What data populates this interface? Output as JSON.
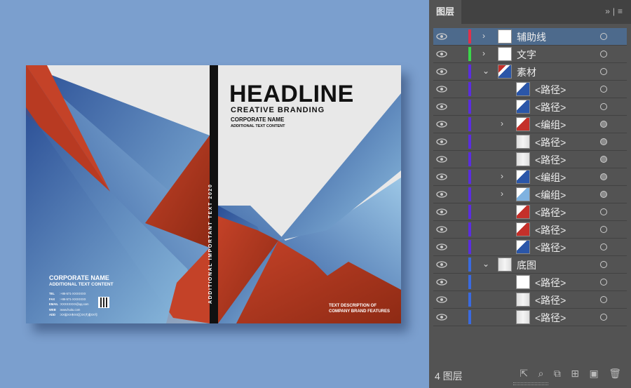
{
  "cover": {
    "headline": "HEADLINE",
    "subtitle": "CREATIVE BRANDING",
    "corporate": "CORPORATE NAME",
    "additional": "ADDITIONAL TEXT CONTENT",
    "spine": "ADDITIONAL IMPORTANT TEXT 2020",
    "back_name": "CORPORATE NAME",
    "back_add": "ADDITIONAL TEXT CONTENT",
    "contacts": [
      {
        "k": "TEL",
        "v": ":+86-571-XXXXXXX"
      },
      {
        "k": "FAX",
        "v": ":+86-571-XXXXXXX"
      },
      {
        "k": "EMAIL",
        "v": ":XXXXXXXX@qq.com"
      },
      {
        "k": "WEB",
        "v": ":www.huitu.com"
      },
      {
        "k": "ADD",
        "v": ":XX省XX市XX区XX大道XX号"
      }
    ],
    "desc1": "TEXT DESCRIPTION OF",
    "desc2": "COMPANY BRAND FEATURES"
  },
  "panel": {
    "tab": "图层",
    "count": "4 图层",
    "rows": [
      {
        "name": "辅助线",
        "color": "#e0314b",
        "chev": "›",
        "indent": 0,
        "thumb": "white",
        "circ": "empty",
        "sel": true
      },
      {
        "name": "文字",
        "color": "#3bd64a",
        "chev": "›",
        "indent": 0,
        "thumb": "text",
        "circ": "empty"
      },
      {
        "name": "素材",
        "color": "#5b2de0",
        "chev": "⌄",
        "indent": 0,
        "thumb": "mix",
        "circ": "empty"
      },
      {
        "name": "<路径>",
        "color": "#5b2de0",
        "chev": "",
        "indent": 1,
        "thumb": "blue",
        "circ": "empty"
      },
      {
        "name": "<路径>",
        "color": "#5b2de0",
        "chev": "",
        "indent": 1,
        "thumb": "blue",
        "circ": "empty"
      },
      {
        "name": "<编组>",
        "color": "#5b2de0",
        "chev": "›",
        "indent": 1,
        "thumb": "red",
        "circ": "fill"
      },
      {
        "name": "<路径>",
        "color": "#5b2de0",
        "chev": "",
        "indent": 1,
        "thumb": "grey",
        "circ": "fill"
      },
      {
        "name": "<路径>",
        "color": "#5b2de0",
        "chev": "",
        "indent": 1,
        "thumb": "grey",
        "circ": "fill"
      },
      {
        "name": "<编组>",
        "color": "#5b2de0",
        "chev": "›",
        "indent": 1,
        "thumb": "blue",
        "circ": "fill"
      },
      {
        "name": "<编组>",
        "color": "#5b2de0",
        "chev": "›",
        "indent": 1,
        "thumb": "lightblue",
        "circ": "fill"
      },
      {
        "name": "<路径>",
        "color": "#5b2de0",
        "chev": "",
        "indent": 1,
        "thumb": "red",
        "circ": "empty"
      },
      {
        "name": "<路径>",
        "color": "#5b2de0",
        "chev": "",
        "indent": 1,
        "thumb": "red",
        "circ": "empty"
      },
      {
        "name": "<路径>",
        "color": "#5b2de0",
        "chev": "",
        "indent": 1,
        "thumb": "blue",
        "circ": "empty"
      },
      {
        "name": "底图",
        "color": "#3a6ae0",
        "chev": "⌄",
        "indent": 0,
        "thumb": "grey",
        "circ": "empty"
      },
      {
        "name": "<路径>",
        "color": "#3a6ae0",
        "chev": "",
        "indent": 1,
        "thumb": "white",
        "circ": "empty"
      },
      {
        "name": "<路径>",
        "color": "#3a6ae0",
        "chev": "",
        "indent": 1,
        "thumb": "grey",
        "circ": "empty"
      },
      {
        "name": "<路径>",
        "color": "#3a6ae0",
        "chev": "",
        "indent": 1,
        "thumb": "grey",
        "circ": "empty"
      }
    ]
  }
}
